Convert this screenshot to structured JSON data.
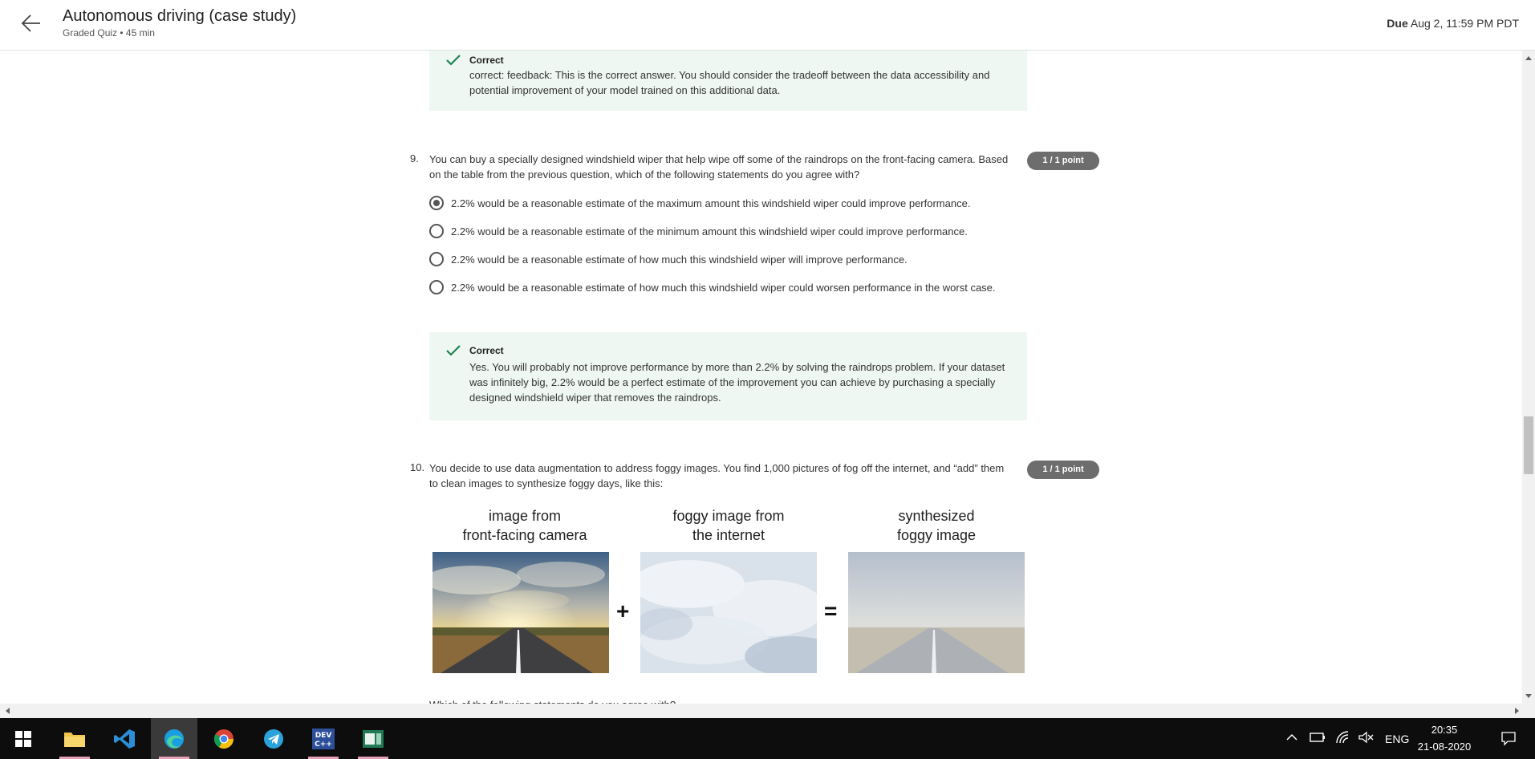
{
  "header": {
    "title": "Autonomous driving (case study)",
    "subtitle": "Graded Quiz • 45 min",
    "due_label": "Due",
    "due_value": "Aug 2, 11:59 PM PDT"
  },
  "feedback_top": {
    "label": "Correct",
    "text": "correct: feedback: This is the correct answer. You should consider the tradeoff between the data accessibility and potential improvement of your model trained on this additional data."
  },
  "q9": {
    "number": "9.",
    "text": "You can buy a specially designed windshield wiper that help wipe off some of the raindrops on the front-facing camera. Based on the table from the previous question, which of the following statements do you agree with?",
    "points": "1 / 1 point",
    "options": [
      "2.2% would be a reasonable estimate of the maximum amount this windshield wiper could improve performance.",
      "2.2% would be a reasonable estimate of the minimum amount this windshield wiper could improve performance.",
      "2.2% would be a reasonable estimate of how much this windshield wiper will improve performance.",
      "2.2% would be a reasonable estimate of how much this windshield wiper could worsen performance in the worst case."
    ],
    "selected_index": 0,
    "feedback": {
      "label": "Correct",
      "text": "Yes. You will probably not improve performance by more than 2.2% by solving the raindrops problem. If your dataset was infinitely big, 2.2% would be a perfect estimate of the improvement you can achieve by purchasing a specially designed windshield wiper that removes the raindrops."
    }
  },
  "q10": {
    "number": "10.",
    "text": "You decide to use data augmentation to address foggy images. You find 1,000 pictures of fog off the internet, and “add” them to clean images to synthesize foggy days, like this:",
    "points": "1 / 1 point",
    "figure": {
      "caption1_line1": "image from",
      "caption1_line2": "front-facing camera",
      "caption2_line1": "foggy image from",
      "caption2_line2": "the internet",
      "caption3_line1": "synthesized",
      "caption3_line2": "foggy image",
      "plus": "+",
      "equals": "="
    },
    "next_line": "Which of the following statements do you agree with?"
  },
  "taskbar": {
    "language": "ENG",
    "time": "20:35",
    "date": "21-08-2020"
  }
}
